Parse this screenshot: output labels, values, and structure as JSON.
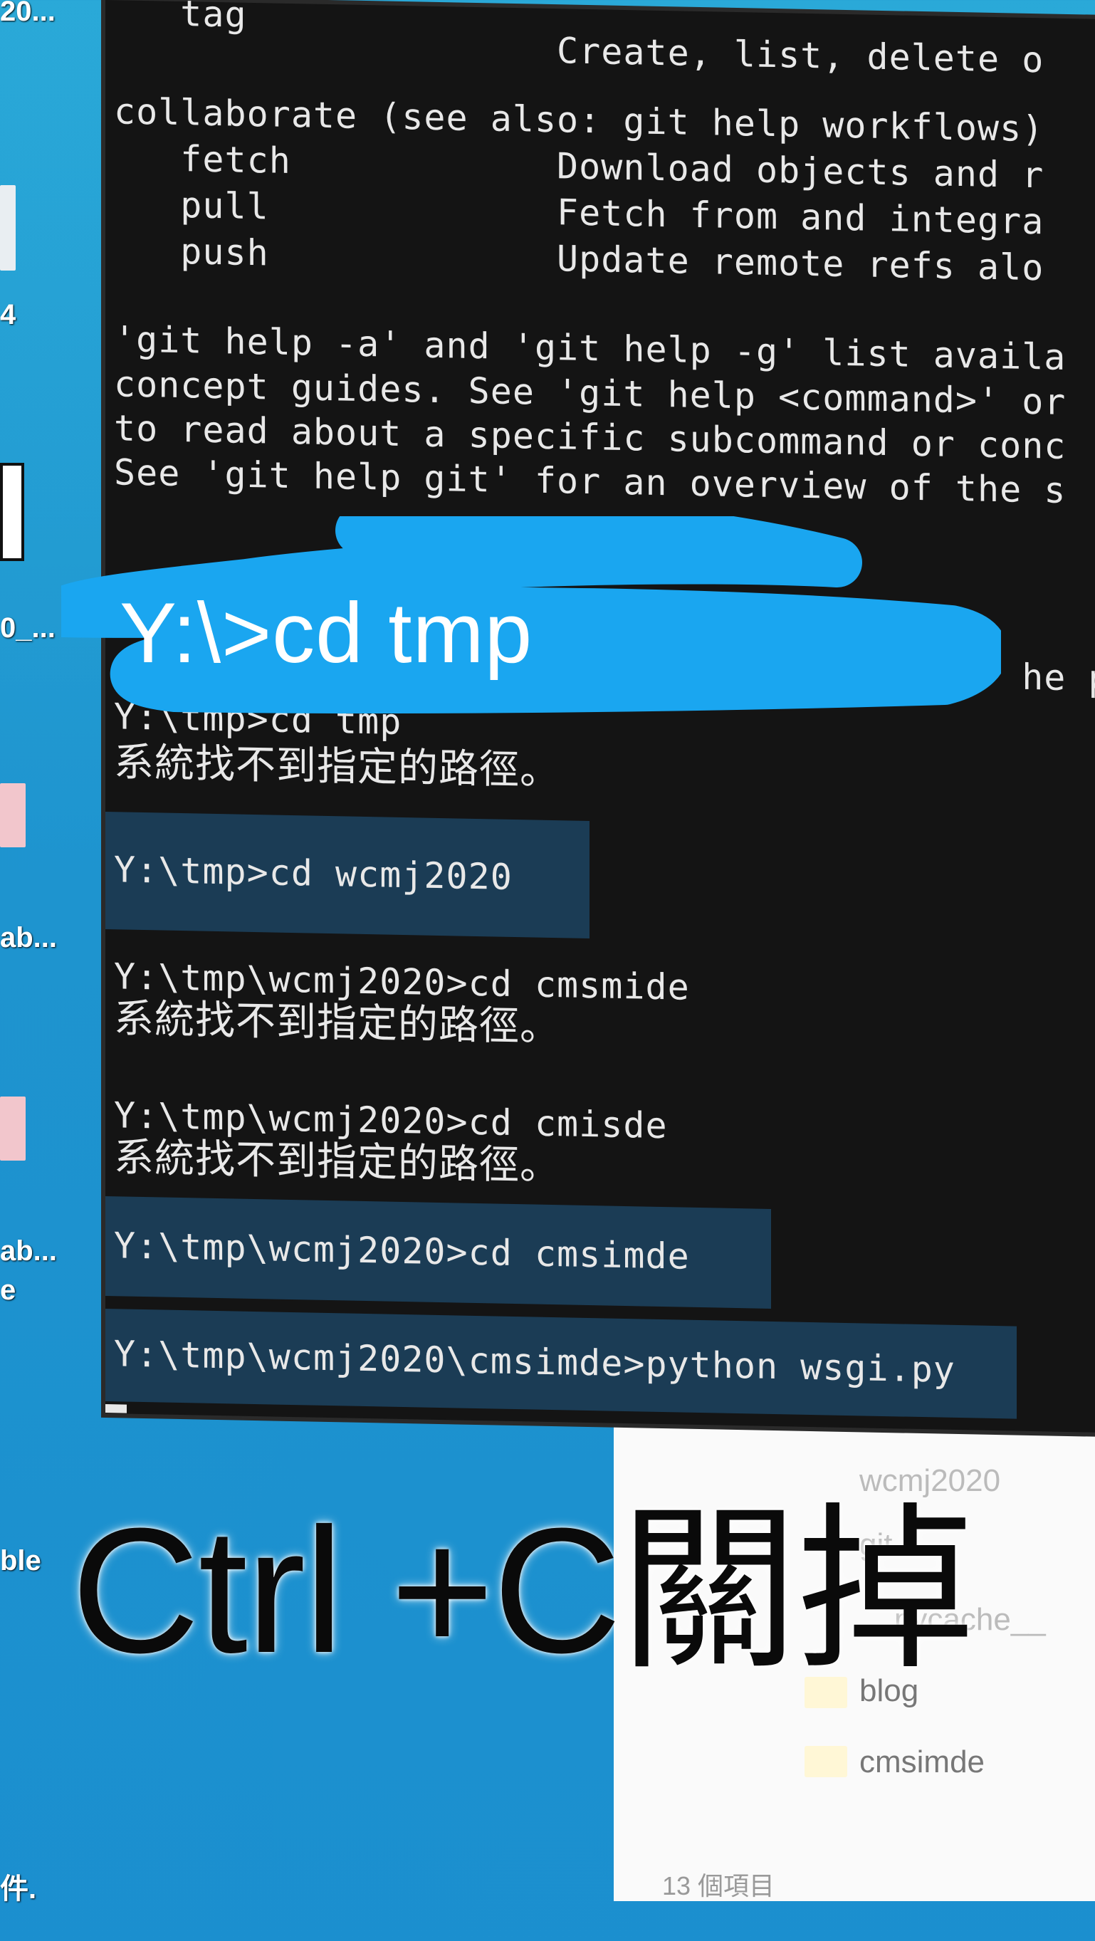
{
  "desktop": {
    "labels": [
      "20...",
      "4",
      "0_...",
      "ab...",
      "ab...",
      "e",
      "ble",
      "件."
    ]
  },
  "terminal": {
    "lines": [
      "   tag",
      "                    Create, list, delete o",
      "collaborate (see also: git help workflows)",
      "   fetch            Download objects and r",
      "   pull             Fetch from and integra",
      "   push             Update remote refs alo",
      "'git help -a' and 'git help -g' list availa",
      "concept guides. See 'git help <command>' or",
      "to read about a specific subcommand or conc",
      "See 'git help git' for an overview of the s",
      "                                         he p",
      "Y:\\tmp>cd tmp",
      "系統找不到指定的路徑。",
      "Y:\\tmp>cd wcmj2020",
      "Y:\\tmp\\wcmj2020>cd cmsmide",
      "系統找不到指定的路徑。",
      "Y:\\tmp\\wcmj2020>cd cmisde",
      "系統找不到指定的路徑。",
      "Y:\\tmp\\wcmj2020>cd cmsimde",
      "Y:\\tmp\\wcmj2020\\cmsimde>python wsgi.py"
    ]
  },
  "explorer": {
    "items": [
      "wcmj2020",
      "git",
      "__pycache__",
      "blog",
      "cmsimde"
    ],
    "status": "13 個項目"
  },
  "annotations": {
    "command": "Y:\\>cd tmp",
    "caption": "Ctrl +C關掉"
  },
  "colors": {
    "scribble": "#1aa6f0",
    "highlight": "#1b3e58"
  }
}
